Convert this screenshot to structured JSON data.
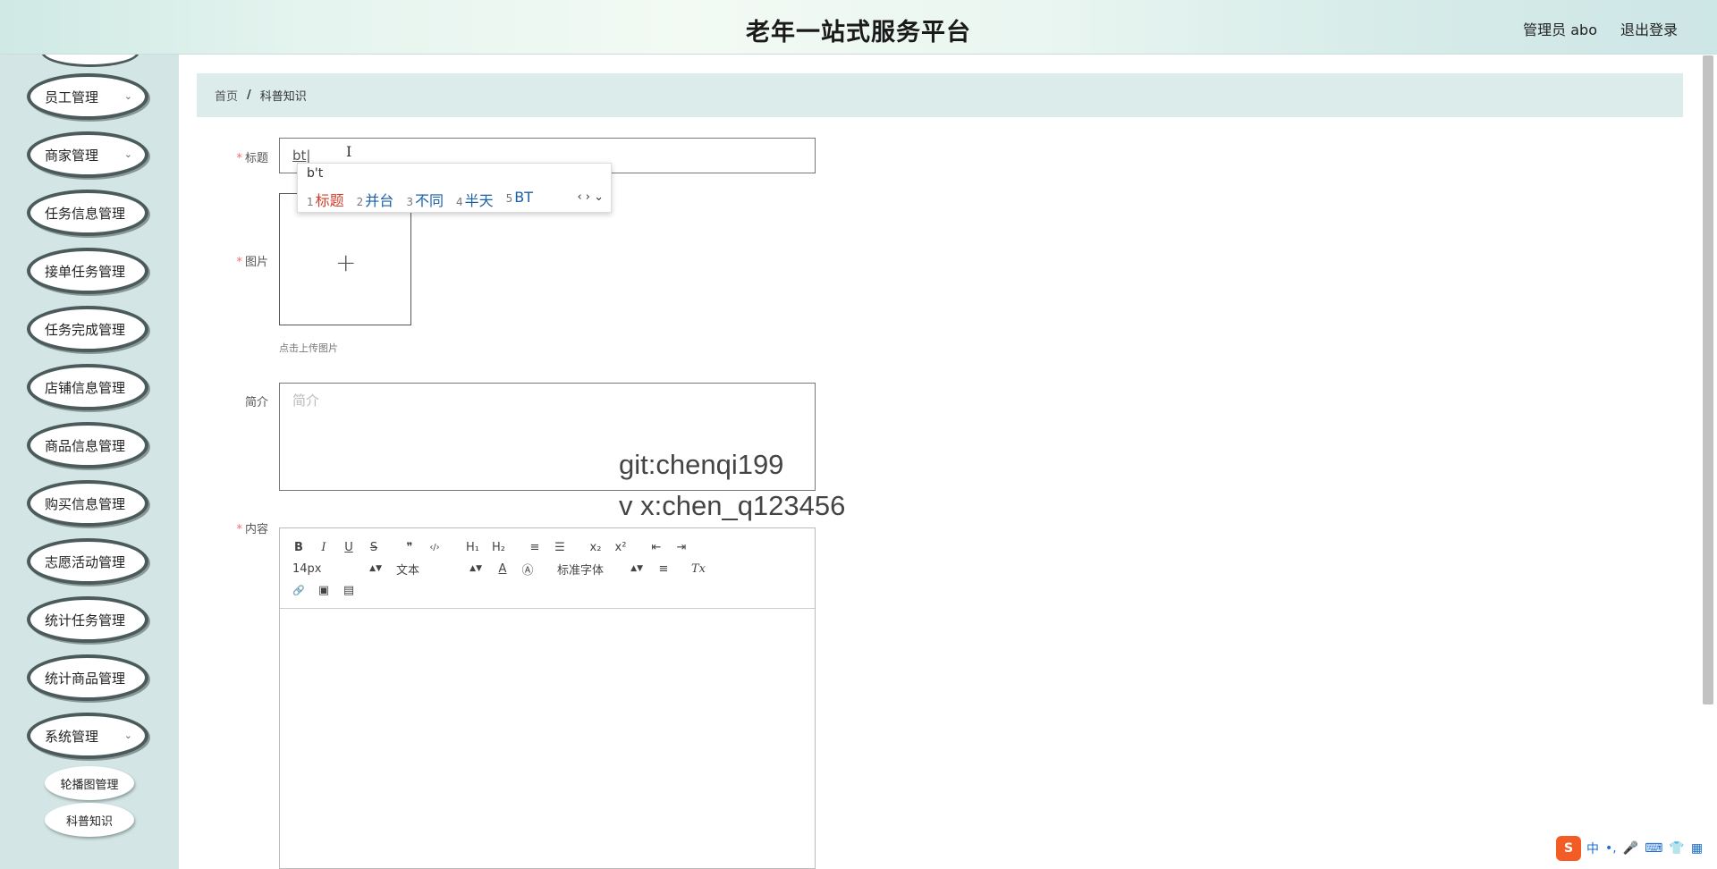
{
  "header": {
    "title": "老年一站式服务平台",
    "user_label": "管理员 abo",
    "logout_label": "退出登录"
  },
  "sidebar": {
    "items": [
      {
        "label": "员工管理",
        "chevron": true
      },
      {
        "label": "商家管理",
        "chevron": true
      },
      {
        "label": "任务信息管理"
      },
      {
        "label": "接单任务管理"
      },
      {
        "label": "任务完成管理"
      },
      {
        "label": "店铺信息管理"
      },
      {
        "label": "商品信息管理"
      },
      {
        "label": "购买信息管理"
      },
      {
        "label": "志愿活动管理"
      },
      {
        "label": "统计任务管理"
      },
      {
        "label": "统计商品管理"
      },
      {
        "label": "系统管理",
        "chevron": true
      }
    ],
    "sub_items": [
      {
        "label": "轮播图管理"
      },
      {
        "label": "科普知识"
      }
    ]
  },
  "breadcrumb": {
    "home": "首页",
    "separator": "/",
    "current": "科普知识"
  },
  "form": {
    "title_label": "标题",
    "title_value": "bt",
    "image_label": "图片",
    "upload_plus": "+",
    "upload_tip": "点击上传图片",
    "intro_label": "简介",
    "intro_placeholder": "简介",
    "content_label": "内容",
    "required_mark": "*"
  },
  "editor": {
    "row1": [
      "B",
      "I",
      "U",
      "S",
      "❞",
      "‹/›",
      "H₁",
      "H₂",
      "≡",
      "☰",
      "x₂",
      "x²",
      "⇤",
      "⇥"
    ],
    "font_size": "14px",
    "format": "文本",
    "font_color_icon": "A",
    "bg_color_icon": "Ⓐ",
    "font_family": "标准字体",
    "align_icon": "≡",
    "clear_icon": "Tx",
    "row3": [
      "🔗",
      "▣",
      "▤"
    ]
  },
  "ime": {
    "composition": "b't",
    "candidates": [
      {
        "n": "1",
        "text": "标题"
      },
      {
        "n": "2",
        "text": "并台"
      },
      {
        "n": "3",
        "text": "不同"
      },
      {
        "n": "4",
        "text": "半天"
      },
      {
        "n": "5",
        "text": "BT"
      }
    ],
    "nav": "‹ › ⌄"
  },
  "watermark": {
    "line1": "git:chenqi199",
    "line2": "v x:chen_q123456"
  },
  "tray": {
    "logo": "S",
    "items": [
      "中",
      "•,",
      "🎤",
      "⌨",
      "👕",
      "▦"
    ]
  }
}
